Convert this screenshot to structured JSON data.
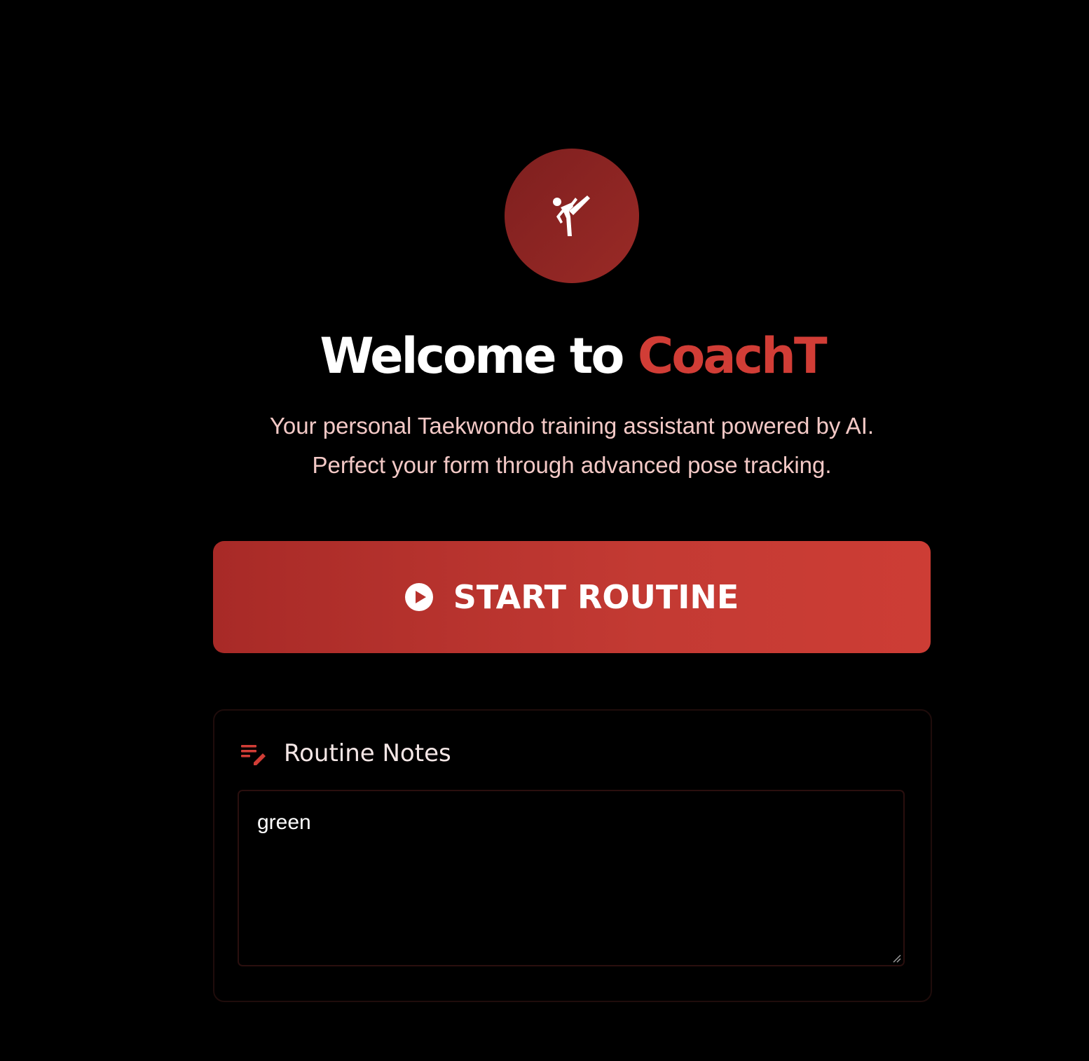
{
  "hero": {
    "logo_icon": "martial-arts-kick-icon",
    "title_prefix": "Welcome to ",
    "title_brand": "CoachT",
    "subtitle_line1": "Your personal Taekwondo training assistant powered by AI.",
    "subtitle_line2": "Perfect your form through advanced pose tracking."
  },
  "actions": {
    "start_label": "START ROUTINE",
    "start_icon": "play-circle-icon"
  },
  "notes": {
    "icon": "edit-note-icon",
    "title": "Routine Notes",
    "value": "green"
  },
  "colors": {
    "background": "#000000",
    "brand_red": "#d13d36",
    "button_gradient_start": "#a82a27",
    "button_gradient_end": "#cd3d35",
    "logo_circle": "#8e2623",
    "subtitle_text": "#f3c9c6"
  }
}
